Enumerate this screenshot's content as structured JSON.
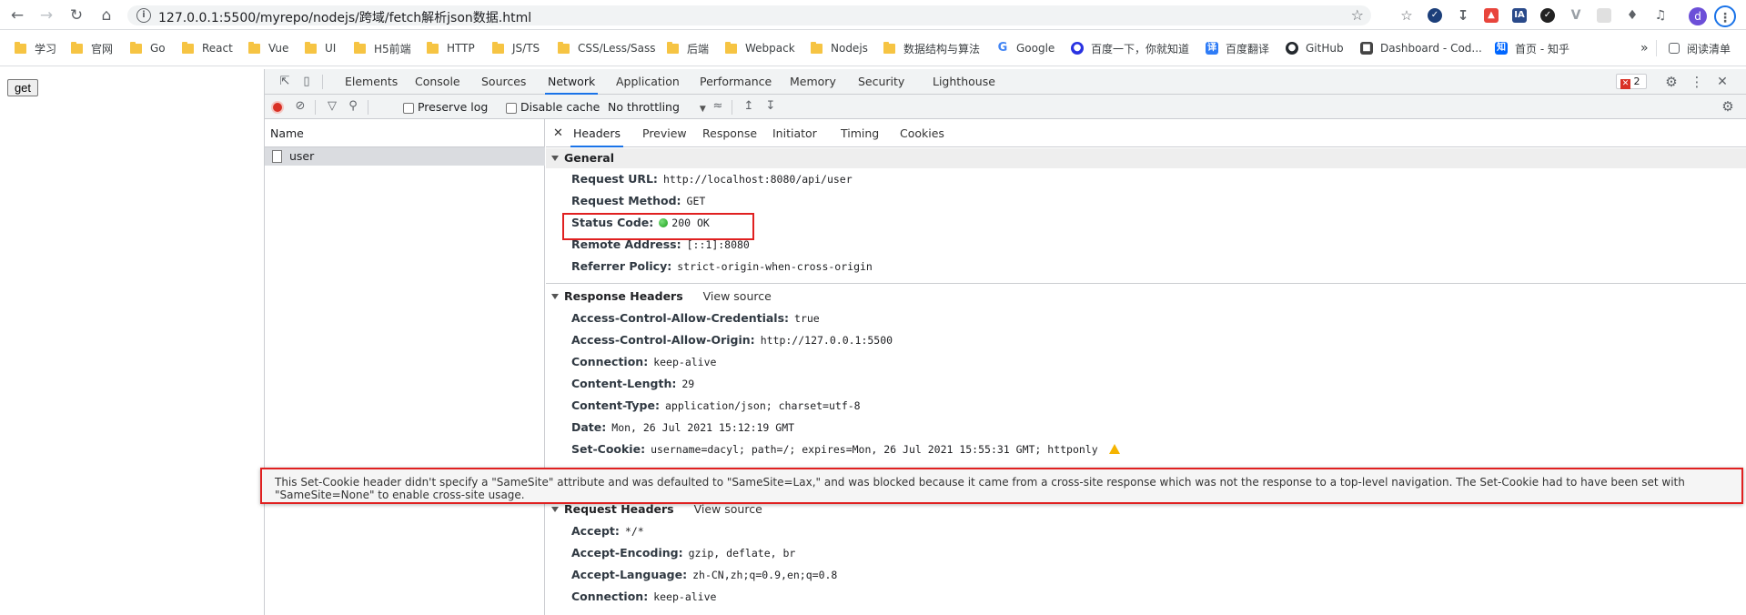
{
  "browser": {
    "url": "127.0.0.1:5500/myrepo/nodejs/跨域/fetch解析json数据.html",
    "bookmarks": [
      {
        "label": "学习",
        "type": "folder"
      },
      {
        "label": "官网",
        "type": "folder"
      },
      {
        "label": "Go",
        "type": "folder"
      },
      {
        "label": "React",
        "type": "folder"
      },
      {
        "label": "Vue",
        "type": "folder"
      },
      {
        "label": "UI",
        "type": "folder"
      },
      {
        "label": "H5前端",
        "type": "folder"
      },
      {
        "label": "HTTP",
        "type": "folder"
      },
      {
        "label": "JS/TS",
        "type": "folder"
      },
      {
        "label": "CSS/Less/Sass",
        "type": "folder"
      },
      {
        "label": "后端",
        "type": "folder"
      },
      {
        "label": "Webpack",
        "type": "folder"
      },
      {
        "label": "Nodejs",
        "type": "folder"
      },
      {
        "label": "数据结构与算法",
        "type": "folder"
      },
      {
        "label": "Google",
        "type": "site"
      },
      {
        "label": "百度一下，你就知道",
        "type": "site"
      },
      {
        "label": "百度翻译",
        "type": "site"
      },
      {
        "label": "GitHub",
        "type": "site"
      },
      {
        "label": "Dashboard - Cod...",
        "type": "site"
      },
      {
        "label": "首页 - 知乎",
        "type": "site"
      }
    ],
    "more_label": "»",
    "reading_list": "阅读清单",
    "profile_initial": "d"
  },
  "page": {
    "get_button": "get"
  },
  "devtools": {
    "tabs": [
      "Elements",
      "Console",
      "Sources",
      "Network",
      "Application",
      "Performance",
      "Memory",
      "Security",
      "Lighthouse"
    ],
    "active_tab": "Network",
    "error_count": "2",
    "toolbar": {
      "preserve_log": "Preserve log",
      "disable_cache": "Disable cache",
      "throttling": "No throttling"
    },
    "name_column": "Name",
    "requests": [
      "user"
    ],
    "detail_tabs": [
      "Headers",
      "Preview",
      "Response",
      "Initiator",
      "Timing",
      "Cookies"
    ],
    "general": {
      "title": "General",
      "rows": [
        {
          "key": "Request URL:",
          "value": "http://localhost:8080/api/user"
        },
        {
          "key": "Request Method:",
          "value": "GET"
        },
        {
          "key": "Status Code:",
          "value": "200 OK"
        },
        {
          "key": "Remote Address:",
          "value": "[::1]:8080"
        },
        {
          "key": "Referrer Policy:",
          "value": "strict-origin-when-cross-origin"
        }
      ]
    },
    "response_headers": {
      "title": "Response Headers",
      "view_source": "View source",
      "rows": [
        {
          "key": "Access-Control-Allow-Credentials:",
          "value": "true"
        },
        {
          "key": "Access-Control-Allow-Origin:",
          "value": "http://127.0.0.1:5500"
        },
        {
          "key": "Connection:",
          "value": "keep-alive"
        },
        {
          "key": "Content-Length:",
          "value": "29"
        },
        {
          "key": "Content-Type:",
          "value": "application/json; charset=utf-8"
        },
        {
          "key": "Date:",
          "value": "Mon, 26 Jul 2021 15:12:19 GMT"
        },
        {
          "key": "Set-Cookie:",
          "value": "username=dacyl; path=/; expires=Mon, 26 Jul 2021 15:55:31 GMT; httponly"
        }
      ]
    },
    "tooltip": "This Set-Cookie header didn't specify a \"SameSite\" attribute and was defaulted to \"SameSite=Lax,\" and was blocked because it came from a cross-site response which was not the response to a top-level navigation. The Set-Cookie had to have been set with \"SameSite=None\" to enable cross-site usage.",
    "request_headers": {
      "title": "Request Headers",
      "view_source": "View source",
      "rows": [
        {
          "key": "Accept:",
          "value": "*/*"
        },
        {
          "key": "Accept-Encoding:",
          "value": "gzip, deflate, br"
        },
        {
          "key": "Accept-Language:",
          "value": "zh-CN,zh;q=0.9,en;q=0.8"
        },
        {
          "key": "Connection:",
          "value": "keep-alive"
        }
      ]
    }
  },
  "colors": {
    "accent": "#1a73e8",
    "highlight_red": "#e02020",
    "status_green": "#1a9e1a"
  }
}
